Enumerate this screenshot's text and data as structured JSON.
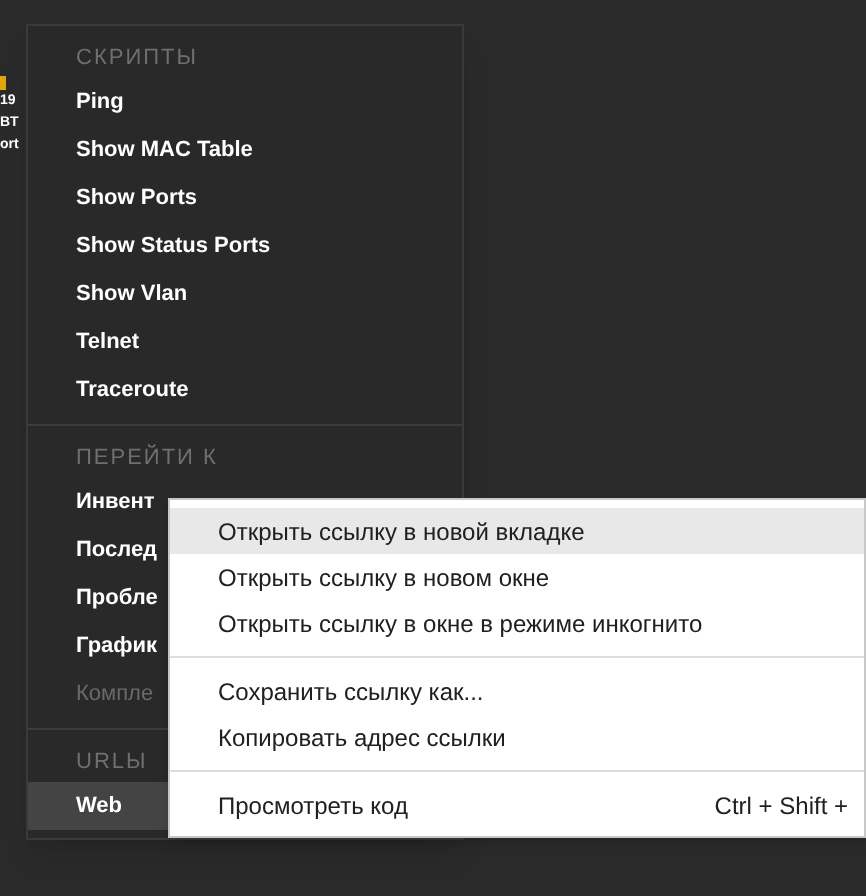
{
  "background": {
    "fragments": [
      "19",
      "BT",
      "ort"
    ]
  },
  "menu": {
    "sections": [
      {
        "title": "СКРИПТЫ",
        "items": [
          {
            "label": "Ping",
            "disabled": false,
            "selected": false
          },
          {
            "label": "Show MAC Table",
            "disabled": false,
            "selected": false
          },
          {
            "label": "Show Ports",
            "disabled": false,
            "selected": false
          },
          {
            "label": "Show Status Ports",
            "disabled": false,
            "selected": false
          },
          {
            "label": "Show Vlan",
            "disabled": false,
            "selected": false
          },
          {
            "label": "Telnet",
            "disabled": false,
            "selected": false
          },
          {
            "label": "Traceroute",
            "disabled": false,
            "selected": false
          }
        ]
      },
      {
        "title": "ПЕРЕЙТИ К",
        "items": [
          {
            "label": "Инвент",
            "disabled": false,
            "selected": false
          },
          {
            "label": "Послед",
            "disabled": false,
            "selected": false
          },
          {
            "label": "Пробле",
            "disabled": false,
            "selected": false
          },
          {
            "label": "График",
            "disabled": false,
            "selected": false
          },
          {
            "label": "Компле",
            "disabled": true,
            "selected": false
          }
        ]
      },
      {
        "title": "URLЫ",
        "items": [
          {
            "label": "Web",
            "disabled": false,
            "selected": true
          }
        ]
      }
    ]
  },
  "context_menu": {
    "groups": [
      [
        {
          "label": "Открыть ссылку в новой вкладке",
          "selected": true
        },
        {
          "label": "Открыть ссылку в новом окне",
          "selected": false
        },
        {
          "label": "Открыть ссылку в окне в режиме инкогнито",
          "selected": false
        }
      ],
      [
        {
          "label": "Сохранить ссылку как...",
          "selected": false
        },
        {
          "label": "Копировать адрес ссылки",
          "selected": false
        }
      ],
      [
        {
          "label": "Просмотреть код",
          "shortcut": "Ctrl + Shift +",
          "selected": false
        }
      ]
    ]
  }
}
